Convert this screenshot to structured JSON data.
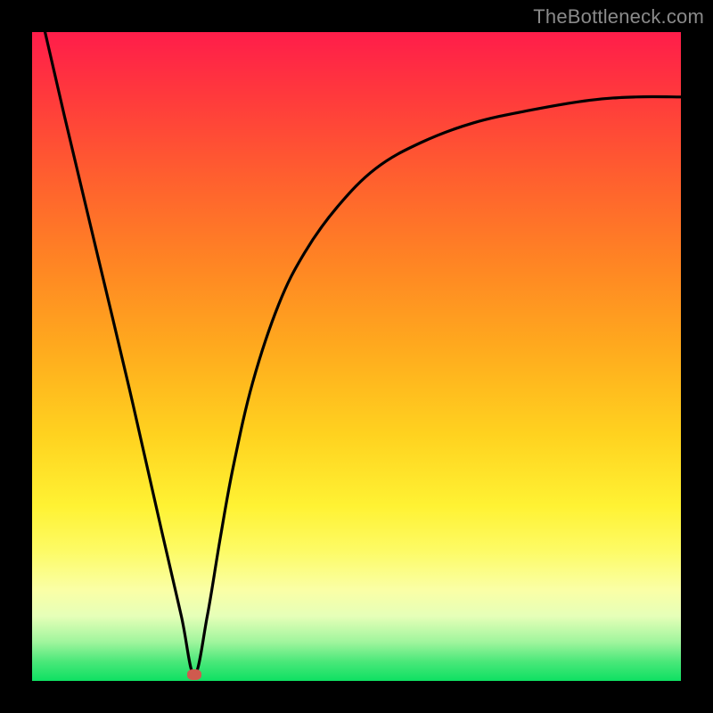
{
  "watermark": "TheBottleneck.com",
  "colors": {
    "frame": "#000000",
    "curve": "#000000",
    "marker": "#cf5a4e",
    "gradient_stops": [
      "#ff1d4a",
      "#ff3a3c",
      "#ff5e2f",
      "#ff8324",
      "#ffa81e",
      "#ffd21f",
      "#fff233",
      "#fdfb66",
      "#faffa6",
      "#e6ffb8",
      "#a0f59d",
      "#4be87a",
      "#0ee062"
    ]
  },
  "chart_data": {
    "type": "line",
    "title": "",
    "xlabel": "",
    "ylabel": "",
    "xlim": [
      0,
      100
    ],
    "ylim": [
      0,
      100
    ],
    "grid": false,
    "legend": false,
    "marker": {
      "x": 25,
      "y": 1
    },
    "series": [
      {
        "name": "curve",
        "x": [
          2,
          5,
          10,
          15,
          20,
          23,
          25,
          27,
          29,
          31,
          34,
          38,
          42,
          47,
          53,
          60,
          68,
          77,
          86,
          93,
          100
        ],
        "y": [
          100,
          87,
          66,
          45,
          23,
          10,
          1,
          10,
          22,
          33,
          46,
          58,
          66,
          73,
          79,
          83,
          86,
          88,
          89.5,
          90,
          90
        ]
      }
    ]
  }
}
